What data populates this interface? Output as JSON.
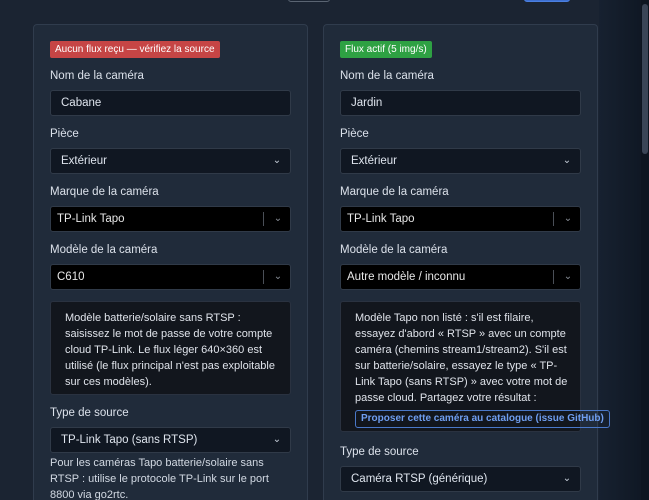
{
  "cameras": [
    {
      "status": "Aucun flux reçu — vérifiez la source",
      "status_color": "#c64545",
      "name_label": "Nom de la caméra",
      "name_value": "Cabane",
      "room_label": "Pièce",
      "room_value": "Extérieur",
      "brand_label": "Marque de la caméra",
      "brand_value": "TP-Link Tapo",
      "model_label": "Modèle de la caméra",
      "model_value": "C610",
      "info": "Modèle batterie/solaire sans RTSP : saisissez le mot de passe de votre compte cloud TP-Link. Le flux léger 640×360 est utilisé (le flux principal n'est pas exploitable sur ces modèles).",
      "source_label": "Type de source",
      "source_value": "TP-Link Tapo (sans RTSP)",
      "source_help": "Pour les caméras Tapo batterie/solaire sans RTSP : utilise le protocole TP-Link sur le port 8800 via go2rtc."
    },
    {
      "status": "Flux actif (5 img/s)",
      "status_color": "#2ea143",
      "name_label": "Nom de la caméra",
      "name_value": "Jardin",
      "room_label": "Pièce",
      "room_value": "Extérieur",
      "brand_label": "Marque de la caméra",
      "brand_value": "TP-Link Tapo",
      "model_label": "Modèle de la caméra",
      "model_value": "Autre modèle / inconnu",
      "info": "Modèle Tapo non listé : s'il est filaire, essayez d'abord « RTSP » avec un compte caméra (chemins stream1/stream2). S'il est sur batterie/solaire, essayez le type « TP-Link Tapo (sans RTSP) » avec votre mot de passe cloud. Partagez votre résultat :",
      "github_button": "Proposer cette caméra au catalogue (issue GitHub)",
      "source_label": "Type de source",
      "source_value": "Caméra RTSP (générique)"
    }
  ],
  "icons": {
    "chevron": "chevron-down-icon"
  }
}
